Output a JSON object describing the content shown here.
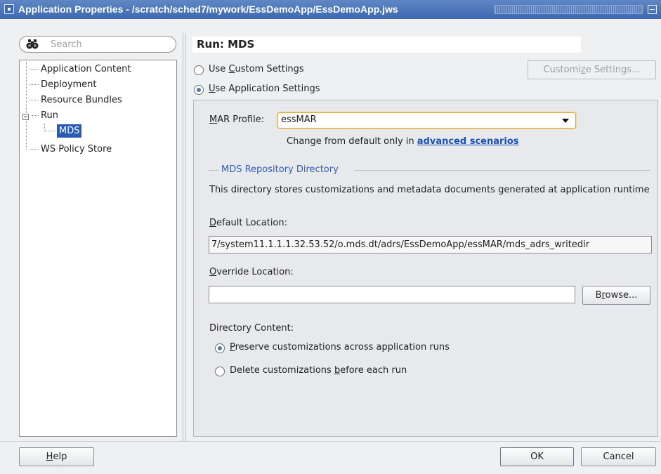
{
  "window": {
    "title": "Application Properties - /scratch/sched7/mywork/EssDemoApp/EssDemoApp.jws"
  },
  "search": {
    "placeholder": "Search"
  },
  "nav": {
    "items": [
      {
        "label": "Application Content"
      },
      {
        "label": "Deployment"
      },
      {
        "label": "Resource Bundles"
      },
      {
        "label": "Run",
        "expanded": true
      },
      {
        "label": "MDS",
        "selected": true
      },
      {
        "label": "WS Policy Store"
      }
    ]
  },
  "panel": {
    "title": "Run: MDS",
    "use_custom": {
      "pre": "Use ",
      "key": "C",
      "post": "ustom Settings",
      "checked": false
    },
    "use_app": {
      "key": "U",
      "post": "se Application Settings",
      "checked": true
    },
    "customize_button": {
      "pre": "Customi",
      "key": "z",
      "post": "e Settings...",
      "enabled": false
    },
    "mar_profile": {
      "label_key": "M",
      "label_post": "AR Profile:",
      "value": "essMAR"
    },
    "change_note": "Change from default only in ",
    "change_link": "advanced scenarios",
    "mds_group": {
      "title": "MDS Repository Directory",
      "description": "This directory stores customizations and metadata documents generated at application runtime",
      "default_location": {
        "label_key": "D",
        "label_post": "efault Location:",
        "value": "7/system11.1.1.1.32.53.52/o.mds.dt/adrs/EssDemoApp/essMAR/mds_adrs_writedir"
      },
      "override_location": {
        "label_key": "O",
        "label_post": "verride Location:",
        "value": ""
      },
      "browse_button": {
        "pre": "B",
        "key": "r",
        "post": "owse..."
      },
      "directory_content": {
        "label": "Directory Content:",
        "preserve": {
          "key": "P",
          "post": "reserve customizations across application runs",
          "checked": true
        },
        "delete": {
          "pre": "Delete customizations ",
          "key": "b",
          "post": "efore each run",
          "checked": false
        }
      }
    }
  },
  "footer": {
    "help": {
      "key": "H",
      "post": "elp"
    },
    "ok": "OK",
    "cancel": "Cancel"
  },
  "colors": {
    "titlebar": "#3e69b1",
    "selection": "#2a5bb4",
    "link": "#1a4fb8",
    "group_title": "#3360b0",
    "focus_border": "#e0a53a"
  }
}
